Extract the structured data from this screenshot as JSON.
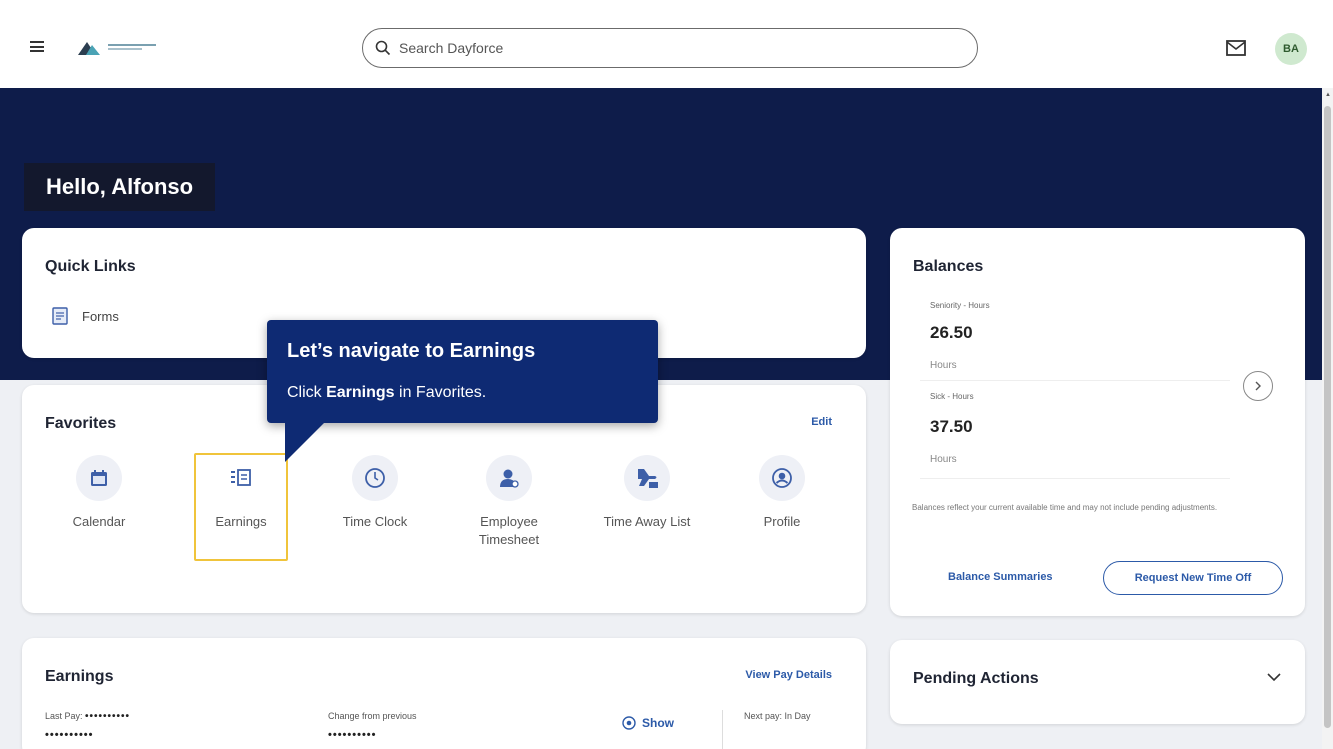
{
  "header": {
    "search_placeholder": "Search Dayforce",
    "avatar_initials": "BA"
  },
  "hero": {
    "greeting": "Hello, Alfonso"
  },
  "quick_links": {
    "title": "Quick Links",
    "items": [
      {
        "label": "Forms",
        "icon": "form-icon"
      }
    ]
  },
  "favorites": {
    "title": "Favorites",
    "edit_label": "Edit",
    "items": [
      {
        "label": "Calendar",
        "icon": "calendar-icon"
      },
      {
        "label": "Earnings",
        "icon": "earnings-icon"
      },
      {
        "label": "Time Clock",
        "icon": "clock-icon"
      },
      {
        "label": "Employee Timesheet",
        "icon": "employee-icon"
      },
      {
        "label": "Time Away List",
        "icon": "plane-icon"
      },
      {
        "label": "Profile",
        "icon": "profile-icon"
      }
    ]
  },
  "earnings": {
    "title": "Earnings",
    "view_pay_details": "View Pay Details",
    "last_pay_label": "Last Pay:",
    "last_pay_mask": "••••••••••",
    "last_pay_mask2": "••••••••••",
    "change_label": "Change from previous",
    "change_mask": "••••••••••",
    "show_label": "Show",
    "next_pay_label": "Next pay: In Day"
  },
  "balances": {
    "title": "Balances",
    "items": [
      {
        "label": "Seniority - Hours",
        "value": "26.50",
        "unit": "Hours"
      },
      {
        "label": "Sick - Hours",
        "value": "37.50",
        "unit": "Hours"
      }
    ],
    "note": "Balances reflect your current available time and may not include pending adjustments.",
    "summary_link": "Balance Summaries",
    "request_button": "Request New Time Off"
  },
  "pending_actions": {
    "title": "Pending Actions"
  },
  "callout": {
    "title": "Let’s navigate to Earnings",
    "text_prefix": "Click ",
    "text_bold": "Earnings",
    "text_suffix": " in Favorites."
  },
  "colors": {
    "hero_bg": "#0e1c4a",
    "callout_bg": "#0e2a73",
    "link": "#2c5aa8",
    "highlight": "#f0c43b",
    "avatar_bg": "#cfe9cf"
  }
}
